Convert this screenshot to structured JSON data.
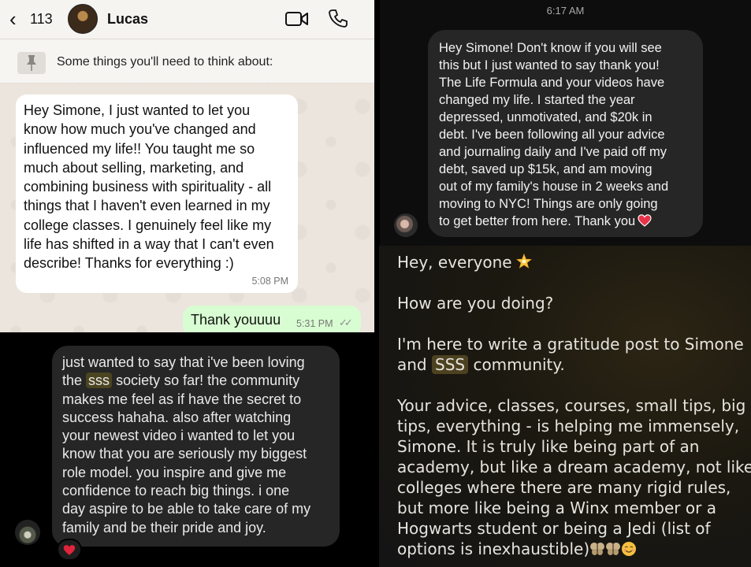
{
  "whatsapp": {
    "back_count": "113",
    "contact_name": "Lucas",
    "pinned_text": "Some things you'll need to think about:",
    "incoming_lines": [
      "Hey Simone, I just wanted to let you",
      "know how much you've changed and",
      "influenced my life!! You taught me so",
      "much about selling, marketing, and",
      "combining business with spirituality - all",
      "things that I haven't even learned in my",
      "college classes. I genuinely feel like my",
      "life has shifted in a way that I can't even",
      "describe! Thanks for everything :)"
    ],
    "incoming_time": "5:08 PM",
    "outgoing_text": "Thank youuuu",
    "outgoing_time": "5:31 PM"
  },
  "dm_top": {
    "timestamp": "6:17 AM",
    "lines": [
      "Hey Simone! Don't know if you will see",
      "this but I just wanted to say thank you!",
      "The Life Formula and your videos have",
      "changed my life. I started the year",
      "depressed, unmotivated, and $20k in",
      "debt. I've been following all your advice",
      "and journaling daily and I've paid off my",
      "debt, saved up $15k, and am moving",
      "out of my family's house in 2 weeks and",
      "moving to NYC! Things are only going",
      "to get better from here. Thank you"
    ]
  },
  "dm_bottom": {
    "line1": "just wanted to say that i've been loving",
    "line2_pre": "the",
    "line2_highlight": "sss",
    "line2_post": "society so far! the community",
    "lines_rest": [
      "makes me feel as if have the secret to",
      "success hahaha. also after watching",
      "your newest video i wanted to let you",
      "know that you are seriously my biggest",
      "role model. you inspire and give me",
      "confidence to reach big things. i one",
      "day aspire to be able to take care of my",
      "family and be their pride and joy."
    ],
    "reaction": "heart"
  },
  "community_post": {
    "greeting": "Hey, everyone",
    "question": "How are you doing?",
    "intro_line1": "I'm here to write a gratitude post to Simone",
    "intro_line2_pre": "and",
    "intro_line2_highlight": "SSS",
    "intro_line2_post": "community.",
    "body_lines": [
      "Your advice, classes, courses, small tips, big",
      "tips, everything - is helping me immensely,",
      "Simone. It is truly like being part of an",
      "academy, but like a dream academy, not like",
      "colleges where there are many rigid rules,",
      "but more like being a Winx member or a",
      "Hogwarts student or being a Jedi (list of",
      "options is inexhaustible)"
    ]
  },
  "colors": {
    "whatsapp_bg": "#ece5dd",
    "whatsapp_outgoing": "#d8fdd2",
    "dm_bubble": "#262626",
    "highlight_gold": "#4d4220"
  }
}
